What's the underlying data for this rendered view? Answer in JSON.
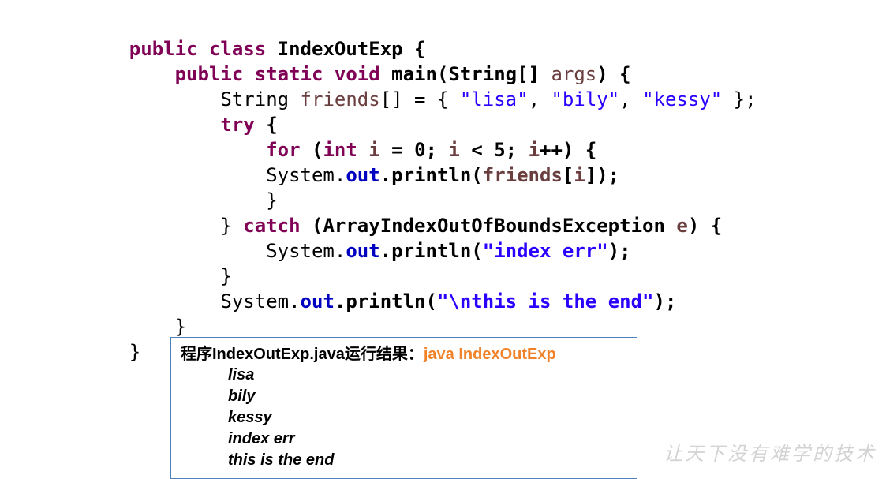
{
  "code": {
    "lines": [
      [
        "public",
        " ",
        "class",
        " IndexOutExp {"
      ],
      [
        "    ",
        "public",
        " ",
        "static",
        " ",
        "void",
        " main(String[] ",
        "args",
        ") {"
      ],
      [
        "        String ",
        "friends",
        "[] = { ",
        "\"lisa\"",
        ", ",
        "\"bily\"",
        ", ",
        "\"kessy\"",
        " };"
      ],
      [
        "        ",
        "try",
        " {"
      ],
      [
        "            ",
        "for",
        " (",
        "int",
        " ",
        "i",
        " = 0; ",
        "i",
        " < 5; ",
        "i",
        "++) {"
      ],
      [
        "            System.",
        "out",
        ".println(",
        "friends",
        "[",
        "i",
        "]);"
      ],
      [
        "            }"
      ],
      [
        "        } ",
        "catch",
        " (ArrayIndexOutOfBoundsException ",
        "e",
        ") {"
      ],
      [
        "            System.",
        "out",
        ".println(",
        "\"index err\"",
        ");"
      ],
      [
        "        }"
      ],
      [
        "        System.",
        "out",
        ".println(",
        "\"\\nthis is the end\"",
        ");"
      ],
      [
        "    }"
      ],
      [
        "}"
      ]
    ]
  },
  "result": {
    "label": "程序IndexOutExp.java运行结果：",
    "command": "java IndexOutExp",
    "output": [
      "lisa",
      "bily",
      "kessy",
      "index err",
      "this is the end"
    ]
  },
  "watermark": "让天下没有难学的技术",
  "colors": {
    "keyword": "#7f0055",
    "string": "#2a00ff",
    "field": "#0000c0",
    "variable": "#6a3e3e",
    "command": "#f0832a",
    "box_border": "#4f81bd"
  }
}
